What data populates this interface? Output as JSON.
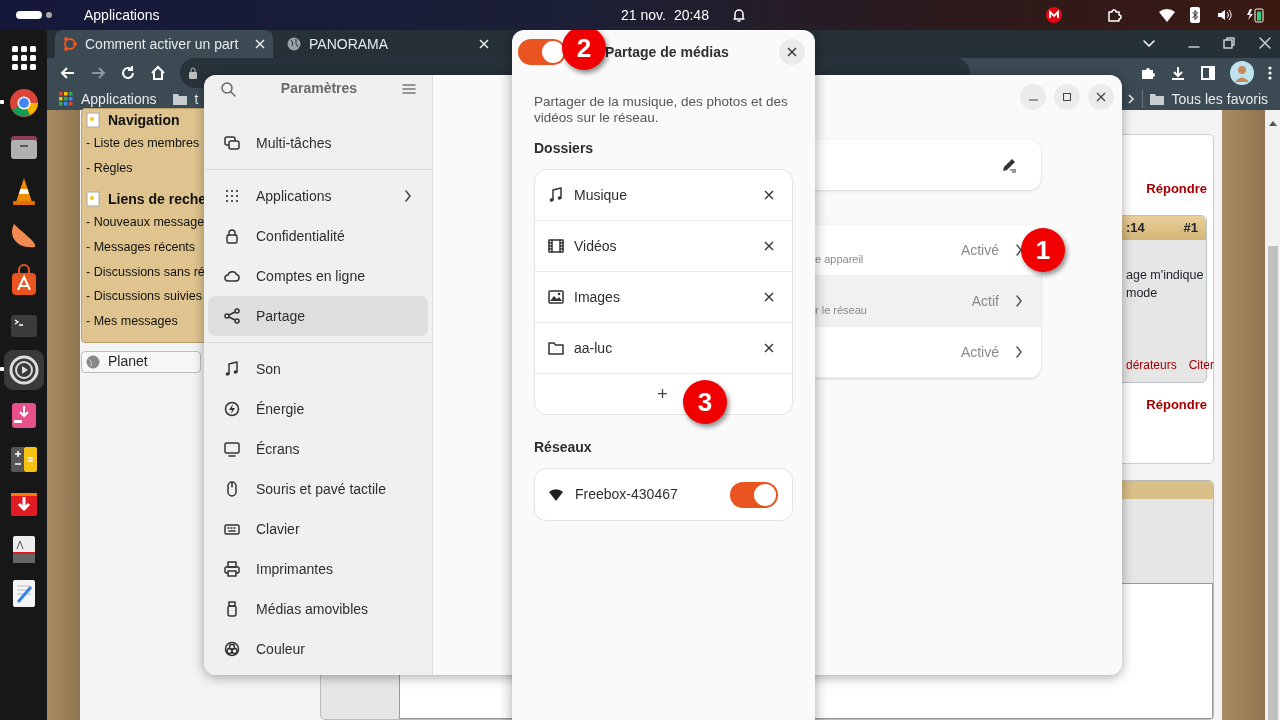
{
  "top_bar": {
    "menu": "Applications",
    "date": "21 nov.",
    "time": "20:48"
  },
  "dock": [
    {
      "running": false,
      "selected": false
    },
    {
      "running": true,
      "selected": false
    },
    {
      "running": false,
      "selected": false
    },
    {
      "running": false,
      "selected": false
    },
    {
      "running": false,
      "selected": false
    },
    {
      "running": false,
      "selected": false
    },
    {
      "running": false,
      "selected": false
    },
    {
      "running": true,
      "selected": true
    },
    {
      "running": false,
      "selected": false
    },
    {
      "running": false,
      "selected": false
    },
    {
      "running": false,
      "selected": false
    },
    {
      "running": false,
      "selected": false
    },
    {
      "running": false,
      "selected": false
    }
  ],
  "browser": {
    "tabs": [
      {
        "title": "Comment activer un part",
        "selected": true
      },
      {
        "title": "PANORAMA",
        "selected": false
      }
    ],
    "bookmarks": [
      "Applications",
      "t"
    ],
    "all_bookmarks": "Tous les favoris",
    "forum": {
      "nav_sections": [
        {
          "title": "Navigation",
          "links": [
            "- Liste des membres",
            "- Règles"
          ]
        },
        {
          "title": "Liens de reche",
          "links": [
            "- Nouveaux message",
            "- Messages récents",
            "- Discussions sans ré",
            "- Discussions suivies",
            "- Mes messages"
          ]
        }
      ],
      "planet": "Planet",
      "reply_links": [
        "Répondre",
        "Répondre"
      ],
      "post": {
        "time": ":14",
        "number": "#1",
        "text_lines": [
          "age m'indique",
          "mode"
        ],
        "links": [
          "dérateurs",
          "Citer"
        ]
      }
    }
  },
  "settings": {
    "title": "Paramètres",
    "sections": [
      [
        {
          "label": "Multi-tâches",
          "submenu": false,
          "selected": false
        }
      ],
      [
        {
          "label": "Applications",
          "submenu": true,
          "selected": false
        },
        {
          "label": "Confidentialité",
          "submenu": false,
          "selected": false
        },
        {
          "label": "Comptes en ligne",
          "submenu": false,
          "selected": false
        },
        {
          "label": "Partage",
          "submenu": false,
          "selected": true
        }
      ],
      [
        {
          "label": "Son",
          "submenu": false,
          "selected": false
        },
        {
          "label": "Énergie",
          "submenu": false,
          "selected": false
        },
        {
          "label": "Écrans",
          "submenu": false,
          "selected": false
        },
        {
          "label": "Souris et pavé tactile",
          "submenu": false,
          "selected": false
        },
        {
          "label": "Clavier",
          "submenu": false,
          "selected": false
        },
        {
          "label": "Imprimantes",
          "submenu": false,
          "selected": false
        },
        {
          "label": "Médias amovibles",
          "submenu": false,
          "selected": false
        },
        {
          "label": "Couleur",
          "submenu": false,
          "selected": false
        }
      ]
    ],
    "rows": [
      {
        "subtitle": "e appareil",
        "status": "Activé",
        "highlighted": false
      },
      {
        "subtitle": "r le réseau",
        "status": "Actif",
        "highlighted": true
      },
      {
        "status": "Activé",
        "highlighted": false
      }
    ]
  },
  "media_dialog": {
    "enabled": true,
    "title": "Partage de médias",
    "description": "Partager de la musique, des photos et des vidéos sur le réseau.",
    "folders_heading": "Dossiers",
    "folders": [
      "Musique",
      "Vidéos",
      "Images",
      "aa-luc"
    ],
    "add_label": "+",
    "networks_heading": "Réseaux",
    "networks": [
      {
        "name": "Freebox-430467",
        "on": true
      }
    ]
  },
  "annotations": [
    "1",
    "2",
    "3"
  ]
}
